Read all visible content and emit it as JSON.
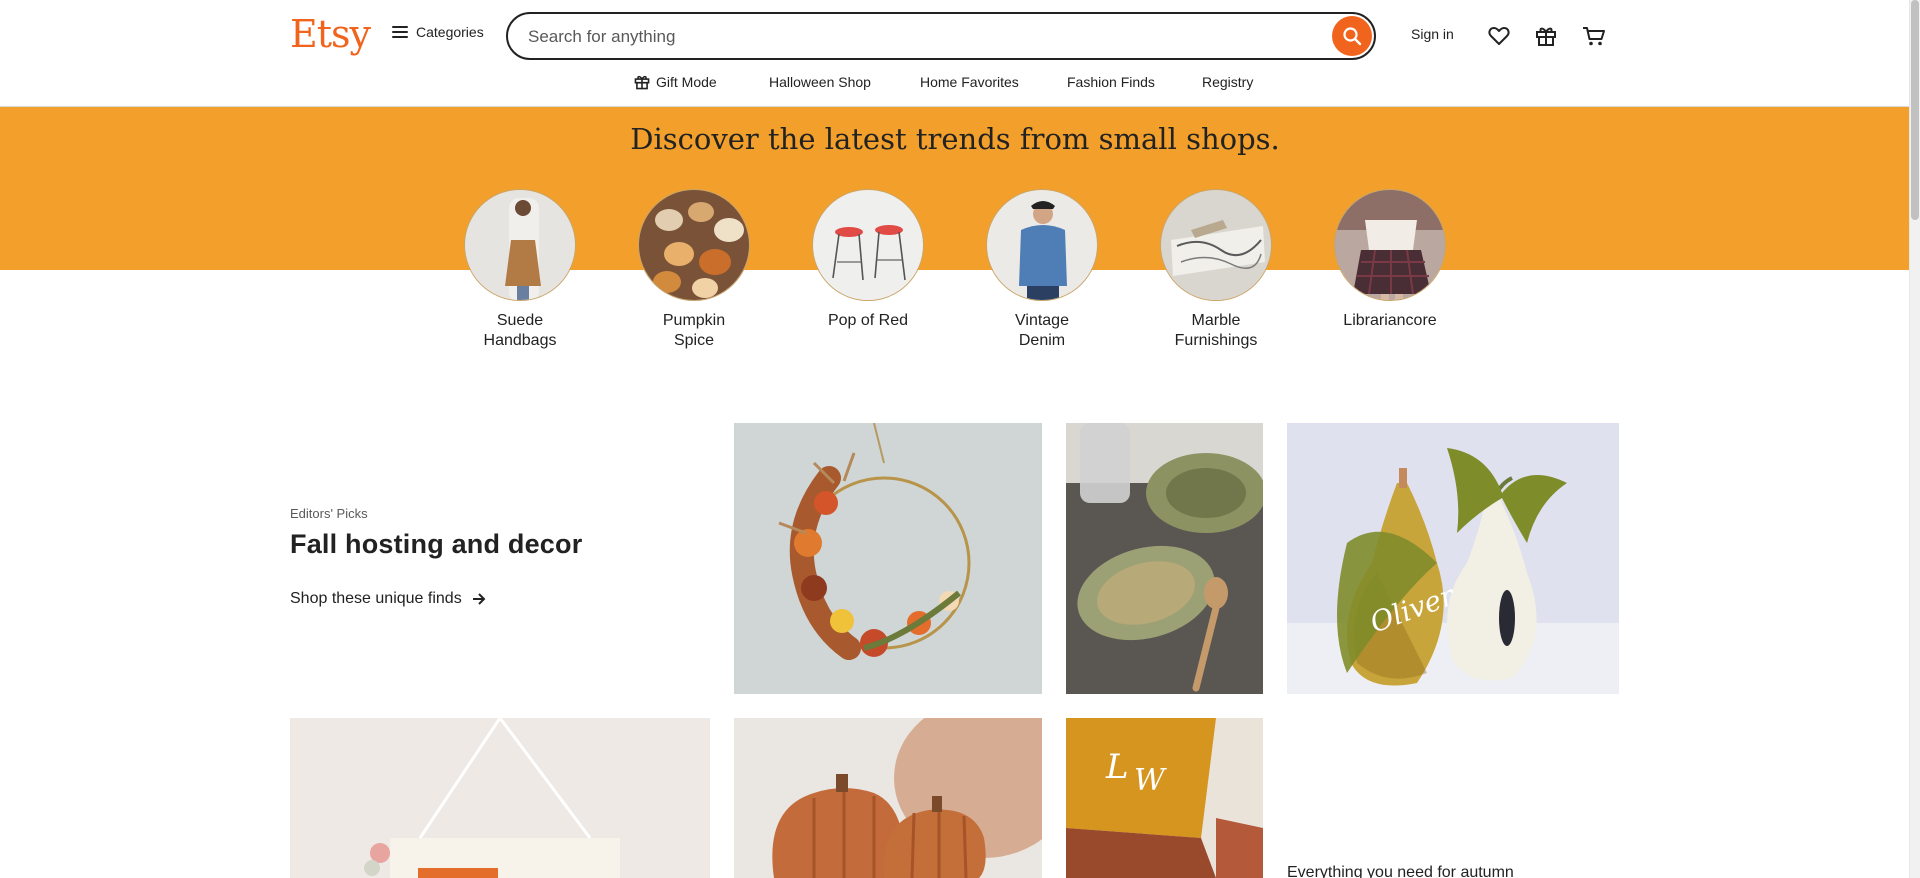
{
  "header": {
    "logo": "Etsy",
    "categories_label": "Categories",
    "search_placeholder": "Search for anything",
    "signin_label": "Sign in",
    "icons": {
      "search": "search-icon",
      "favorites": "heart-icon",
      "gift": "gift-icon",
      "cart": "cart-icon",
      "menu": "hamburger-icon"
    }
  },
  "nav": [
    {
      "label": "Gift Mode",
      "icon": "gift-icon"
    },
    {
      "label": "Halloween Shop"
    },
    {
      "label": "Home Favorites"
    },
    {
      "label": "Fashion Finds"
    },
    {
      "label": "Registry"
    }
  ],
  "hero": {
    "title": "Discover the latest trends from small shops.",
    "categories": [
      {
        "line1": "Suede",
        "line2": "Handbags"
      },
      {
        "line1": "Pumpkin",
        "line2": "Spice"
      },
      {
        "line1": "Pop of Red",
        "line2": ""
      },
      {
        "line1": "Vintage",
        "line2": "Denim"
      },
      {
        "line1": "Marble",
        "line2": "Furnishings"
      },
      {
        "line1": "Librariancore",
        "line2": ""
      }
    ]
  },
  "editors_picks": {
    "caption": "Editors' Picks",
    "title": "Fall hosting and decor",
    "link_label": "Shop these unique finds",
    "link_icon": "arrow-right-icon",
    "tile_text": "Everything you need for autumn"
  },
  "colors": {
    "brand": "#f1641e",
    "hero_background": "#f2a02b",
    "text": "#222222"
  }
}
